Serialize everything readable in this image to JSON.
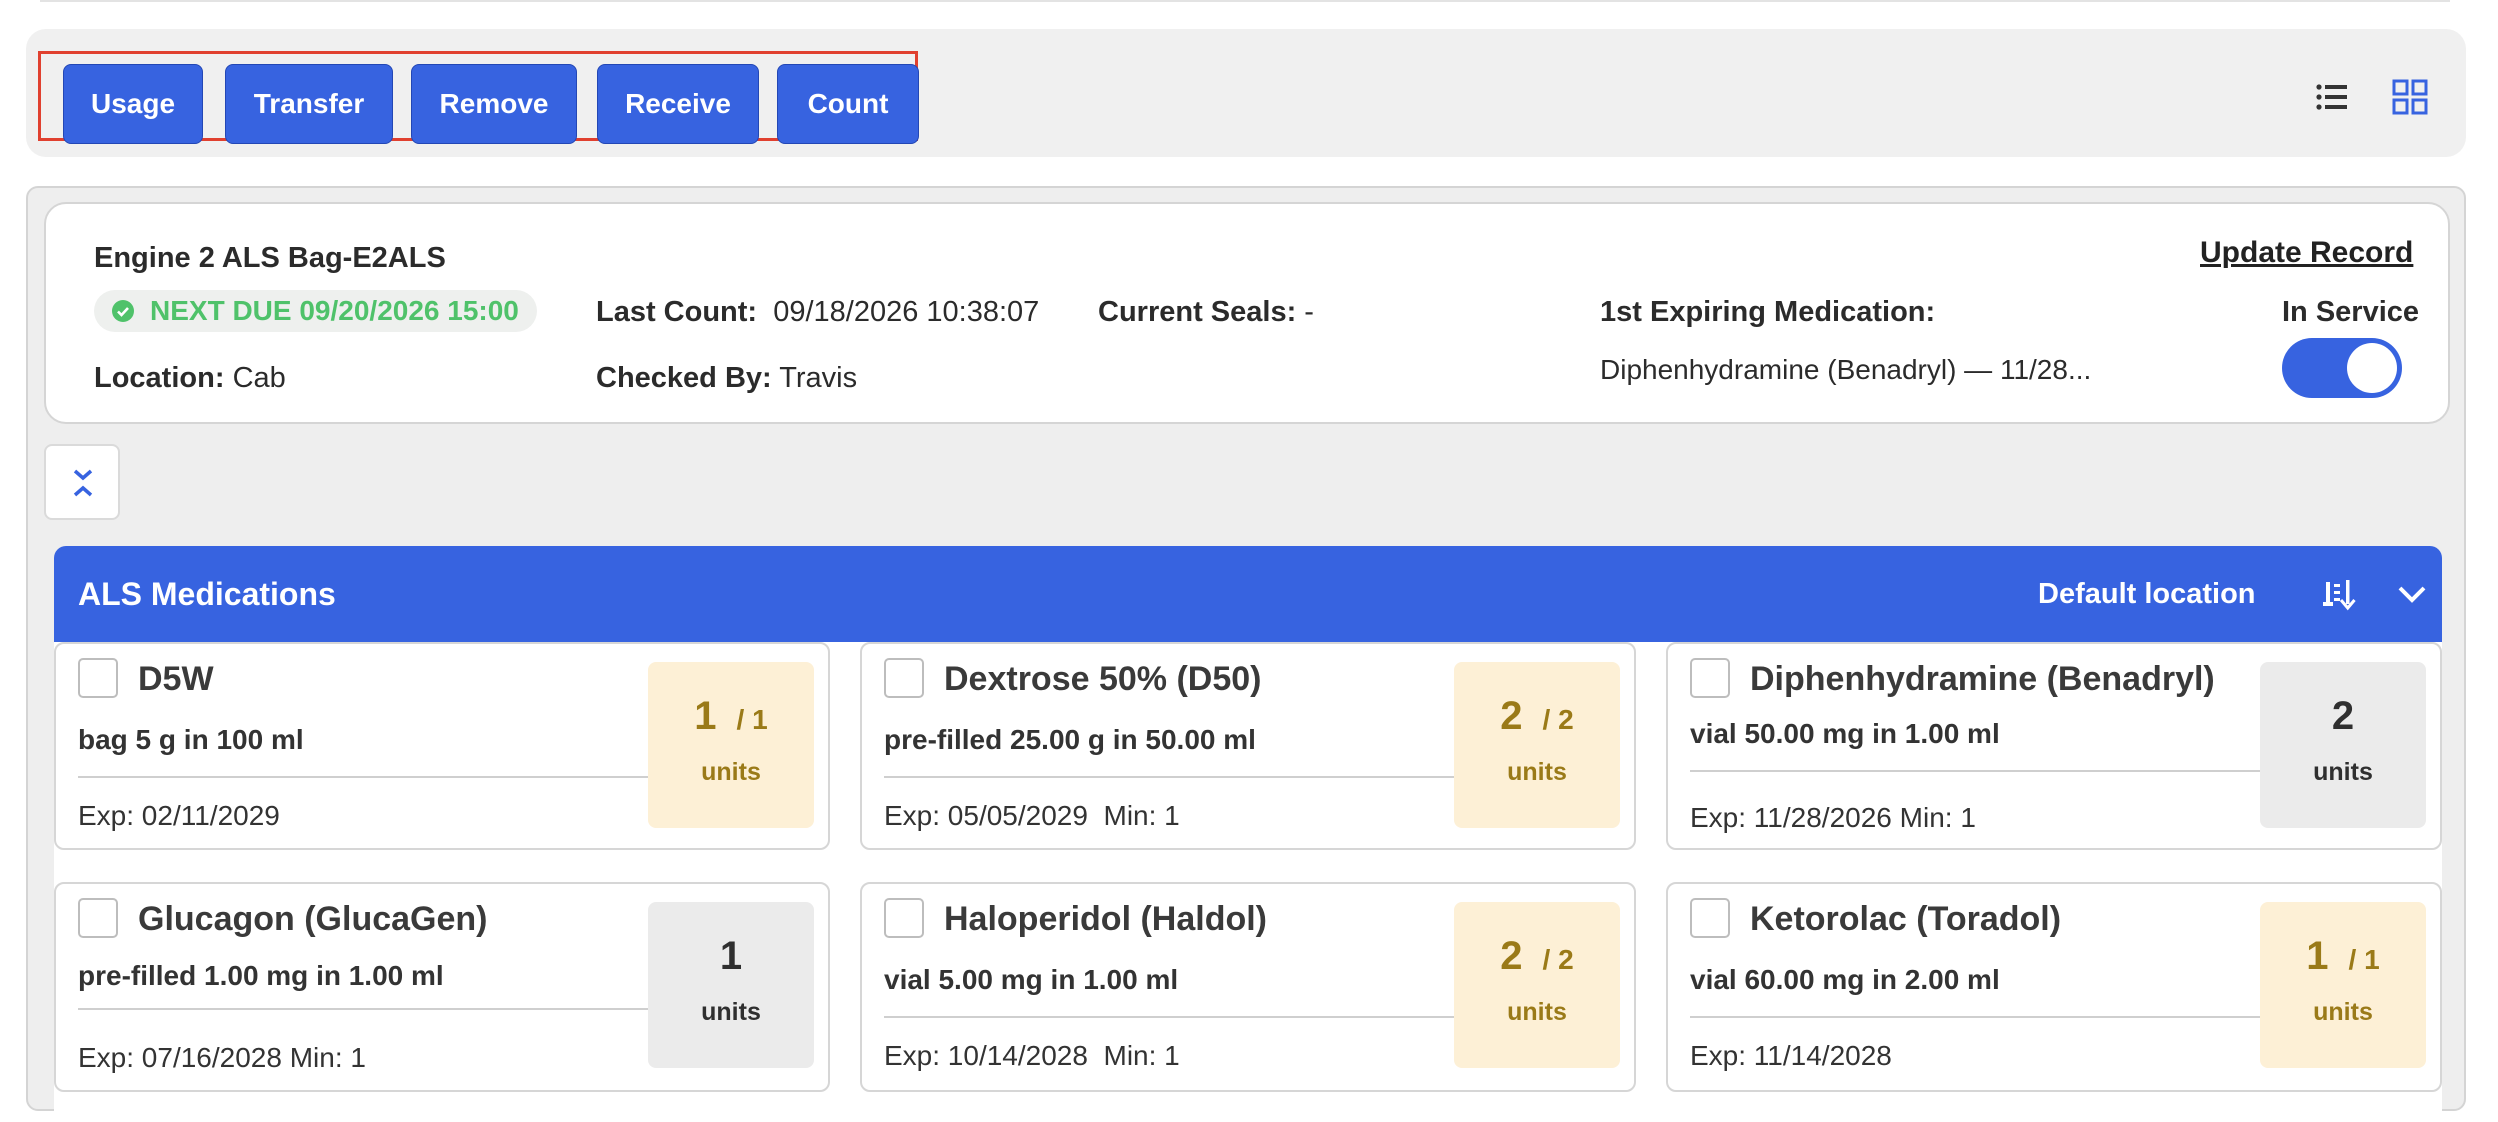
{
  "toolbar": {
    "buttons": [
      "Usage",
      "Transfer",
      "Remove",
      "Receive",
      "Count"
    ],
    "accent": "#3763e0",
    "highlight_border": "#e0402f",
    "icons": [
      "list-view-icon",
      "grid-view-icon"
    ]
  },
  "record": {
    "title": "Engine 2 ALS Bag-E2ALS",
    "next_due": "NEXT DUE 09/20/2026 15:00",
    "location_label": "Location:",
    "location_value": "Cab",
    "last_count_label": "Last Count:",
    "last_count_value": "09/18/2026 10:38:07",
    "checked_by_label": "Checked By:",
    "checked_by_value": "Travis",
    "current_seals_label": "Current Seals:",
    "current_seals_value": "-",
    "first_expiring_label": "1st Expiring Medication:",
    "first_expiring_value": "Diphenhydramine (Benadryl) — 11/28...",
    "update_record": "Update Record",
    "in_service_label": "In Service",
    "in_service": true
  },
  "category": {
    "title": "ALS Medications",
    "location": "Default location"
  },
  "cards": [
    {
      "name": "D5W",
      "desc": "bag 5 g in 100 ml",
      "exp": "Exp: 02/11/2029",
      "qty": "1",
      "of": "/ 1",
      "unit": "units",
      "status": "warn"
    },
    {
      "name": "Dextrose 50% (D50)",
      "desc": "pre-filled 25.00 g in 50.00 ml",
      "exp": "Exp: 05/05/2029  Min: 1",
      "qty": "2",
      "of": "/ 2",
      "unit": "units",
      "status": "warn"
    },
    {
      "name": "Diphenhydramine (Benadryl)",
      "desc": "vial 50.00 mg in 1.00 ml",
      "exp": "Exp: 11/28/2026 Min: 1",
      "qty": "2",
      "of": "",
      "unit": "units",
      "status": "plain"
    },
    {
      "name": "Glucagon (GlucaGen)",
      "desc": "pre-filled 1.00 mg in 1.00 ml",
      "exp": "Exp: 07/16/2028 Min: 1",
      "qty": "1",
      "of": "",
      "unit": "units",
      "status": "plain"
    },
    {
      "name": "Haloperidol (Haldol)",
      "desc": "vial 5.00 mg in 1.00 ml",
      "exp": "Exp: 10/14/2028  Min: 1",
      "qty": "2",
      "of": "/ 2",
      "unit": "units",
      "status": "warn"
    },
    {
      "name": "Ketorolac (Toradol)",
      "desc": "vial 60.00 mg in 2.00 ml",
      "exp": "Exp: 11/14/2028",
      "qty": "1",
      "of": "/ 1",
      "unit": "units",
      "status": "warn"
    }
  ]
}
